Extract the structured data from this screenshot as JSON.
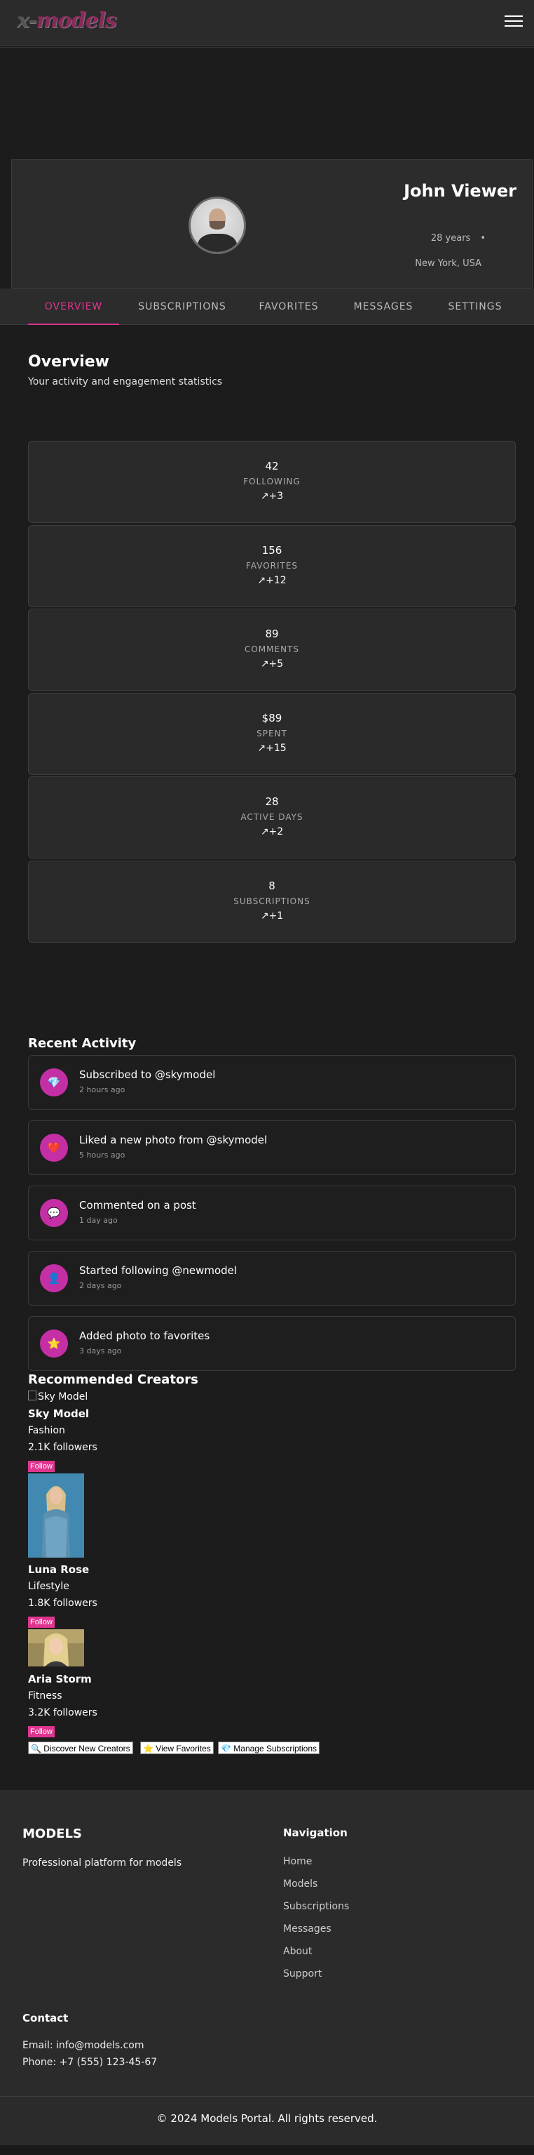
{
  "header": {
    "logo_prefix": "x-",
    "logo_main": "models"
  },
  "profile": {
    "name": "John Viewer",
    "age": "28 years",
    "separator": "•",
    "location": "New York, USA"
  },
  "tabs": [
    {
      "label": "OVERVIEW"
    },
    {
      "label": "SUBSCRIPTIONS"
    },
    {
      "label": "FAVORITES"
    },
    {
      "label": "MESSAGES"
    },
    {
      "label": "SETTINGS"
    }
  ],
  "overview": {
    "title": "Overview",
    "subtitle": "Your activity and engagement statistics"
  },
  "stats": [
    {
      "value": "42",
      "label": "FOLLOWING",
      "change": "↗+3"
    },
    {
      "value": "156",
      "label": "FAVORITES",
      "change": "↗+12"
    },
    {
      "value": "89",
      "label": "COMMENTS",
      "change": "↗+5"
    },
    {
      "value": "$89",
      "label": "SPENT",
      "change": "↗+15"
    },
    {
      "value": "28",
      "label": "ACTIVE DAYS",
      "change": "↗+2"
    },
    {
      "value": "8",
      "label": "SUBSCRIPTIONS",
      "change": "↗+1"
    }
  ],
  "activity": {
    "title": "Recent Activity",
    "items": [
      {
        "icon": "💎",
        "icon_name": "diamond-icon",
        "text": "Subscribed to @skymodel",
        "time": "2 hours ago"
      },
      {
        "icon": "❤️",
        "icon_name": "heart-icon",
        "text": "Liked a new photo from @skymodel",
        "time": "5 hours ago"
      },
      {
        "icon": "💬",
        "icon_name": "speech-bubble-icon",
        "text": "Commented on a post",
        "time": "1 day ago"
      },
      {
        "icon": "👤",
        "icon_name": "user-icon",
        "text": "Started following @newmodel",
        "time": "2 days ago"
      },
      {
        "icon": "⭐",
        "icon_name": "star-icon",
        "text": "Added photo to favorites",
        "time": "3 days ago"
      }
    ]
  },
  "recommended": {
    "title": "Recommended Creators",
    "creators": [
      {
        "alt": "Sky Model",
        "name": "Sky Model",
        "category": "Fashion",
        "followers": "2.1K followers",
        "follow": "Follow"
      },
      {
        "alt": "Luna Rose",
        "name": "Luna Rose",
        "category": "Lifestyle",
        "followers": "1.8K followers",
        "follow": "Follow"
      },
      {
        "alt": "Aria Storm",
        "name": "Aria Storm",
        "category": "Fitness",
        "followers": "3.2K followers",
        "follow": "Follow"
      }
    ]
  },
  "quick_actions": [
    {
      "label": "🔍 Discover New Creators"
    },
    {
      "label": "⭐ View Favorites"
    },
    {
      "label": "💎 Manage Subscriptions"
    }
  ],
  "footer": {
    "brand": "MODELS",
    "description": "Professional platform for models",
    "nav_title": "Navigation",
    "nav": [
      "Home",
      "Models",
      "Subscriptions",
      "Messages",
      "About",
      "Support"
    ],
    "contact_title": "Contact",
    "email": "Email: info@models.com",
    "phone": "Phone: +7 (555) 123-45-67",
    "copyright": "© 2024 Models Portal. All rights reserved."
  },
  "colors": {
    "accent": "#e0358f",
    "activity_icon_bg": "#c52fa5",
    "background": "#1c1c1c",
    "card": "#2a2a2a"
  }
}
